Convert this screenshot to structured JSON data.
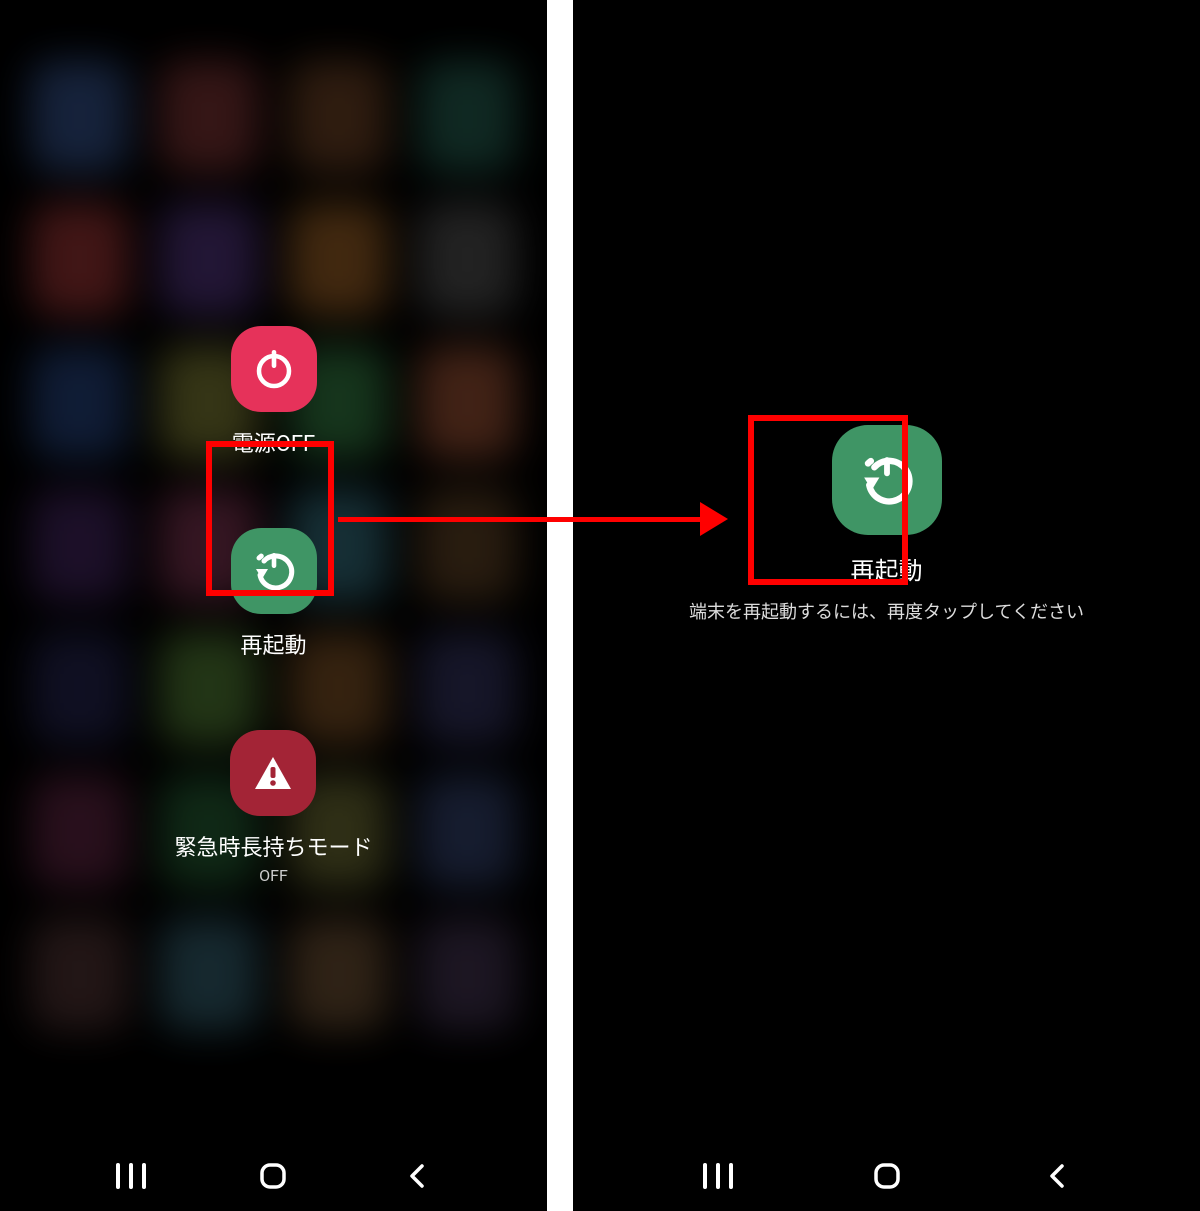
{
  "left": {
    "powerOff": {
      "label": "電源OFF"
    },
    "restart": {
      "label": "再起動"
    },
    "emergency": {
      "label": "緊急時長持ちモード",
      "sub": "OFF"
    }
  },
  "right": {
    "restart": {
      "label": "再起動"
    },
    "instruction": "端末を再起動するには、再度タップしてください"
  },
  "colors": {
    "highlight": "#ff0000",
    "power_red": "#e6325a",
    "restart_green": "#3f9565",
    "emergency_red": "#a32436"
  }
}
